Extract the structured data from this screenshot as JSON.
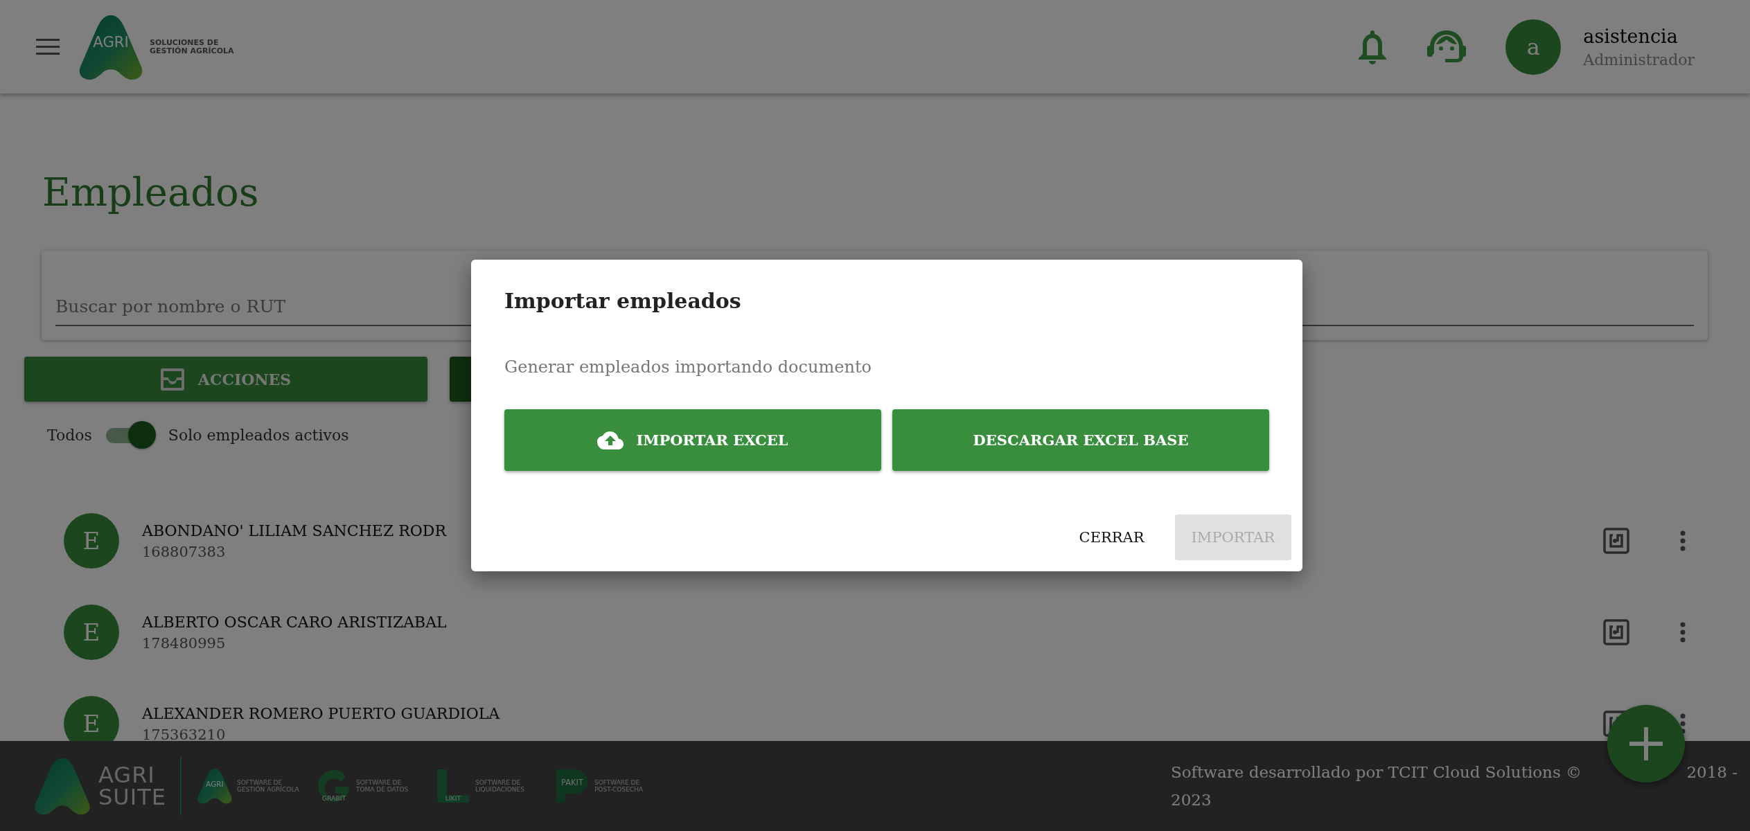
{
  "header": {
    "logo": {
      "mark": "AGRI",
      "tagline": [
        "SOLUCIONES DE",
        "GESTIÓN AGRÍCOLA"
      ]
    },
    "user": {
      "initial": "a",
      "name": "asistencia",
      "role": "Administrador"
    }
  },
  "page": {
    "title": "Empleados",
    "search": {
      "placeholder": "Buscar por nombre o RUT"
    },
    "toolbar_buttons": [
      {
        "kind": "actions",
        "label": "ACCIONES"
      },
      {
        "kind": "covered"
      }
    ],
    "filter": {
      "off_label": "Todos",
      "on_label": "Solo empleados activos",
      "on": true
    },
    "employees": [
      {
        "initial": "E",
        "name": "ABONDANO' LILIAM SANCHEZ RODR",
        "rut": "168807383"
      },
      {
        "initial": "E",
        "name": "ALBERTO OSCAR CARO ARISTIZABAL",
        "rut": "178480995"
      },
      {
        "initial": "E",
        "name": "ALEXANDER ROMERO PUERTO GUARDIOLA",
        "rut": "175363210"
      }
    ]
  },
  "footer": {
    "suite": [
      "AGRI",
      "SUITE"
    ],
    "products": [
      {
        "kind": "agri",
        "mark": "AGRI",
        "tagline": [
          "SOFTWARE DE",
          "GESTIÓN AGRÍCOLA"
        ]
      },
      {
        "kind": "grabit",
        "mark": "GRABIT",
        "tagline": [
          "SOFTWARE DE",
          "TOMA DE DATOS"
        ]
      },
      {
        "kind": "likit",
        "mark": "LIKIT",
        "tagline": [
          "SOFTWARE DE",
          "LIQUIDACIONES"
        ]
      },
      {
        "kind": "pakit",
        "mark": "PAKIT",
        "tagline": [
          "SOFTWARE DE",
          "POST-COSECHA"
        ]
      }
    ],
    "copyright": [
      "Software desarrollado por TCIT Cloud Solutions ©",
      "2018 -",
      "2023"
    ]
  },
  "dialog": {
    "title": "Importar empleados",
    "message": "Generar empleados importando documento",
    "actions": [
      {
        "kind": "upload",
        "label": "IMPORTAR EXCEL"
      },
      {
        "kind": "plain",
        "label": "DESCARGAR EXCEL BASE"
      }
    ],
    "footer_buttons": [
      {
        "label": "CERRAR",
        "disabled": false
      },
      {
        "label": "IMPORTAR",
        "disabled": true
      }
    ]
  }
}
